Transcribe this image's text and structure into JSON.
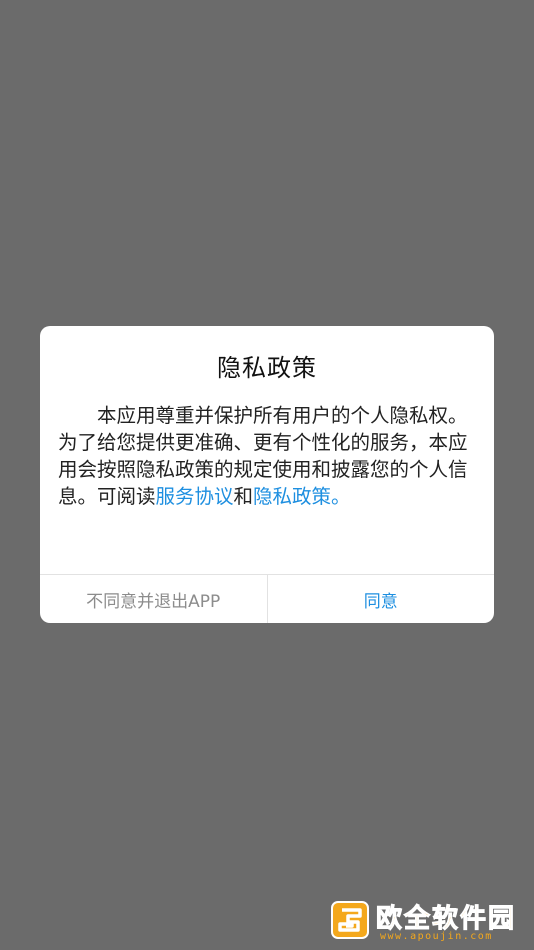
{
  "dialog": {
    "title": "隐私政策",
    "body_text": "本应用尊重并保护所有用户的个人隐私权。为了给您提供更准确、更有个性化的服务，本应用会按照隐私政策的规定使用和披露您的个人信息。可阅读",
    "link_service": "服务协议",
    "conjunction": "和",
    "link_privacy": "隐私政策。",
    "decline_button": "不同意并退出APP",
    "agree_button": "同意"
  },
  "watermark": {
    "name": "欧全软件园",
    "url": "www.apoujin.com"
  },
  "colors": {
    "overlay": "#6b6b6b",
    "link": "#1e8fe0",
    "decline_text": "#8c8c8c",
    "watermark": "#f4a81c"
  }
}
